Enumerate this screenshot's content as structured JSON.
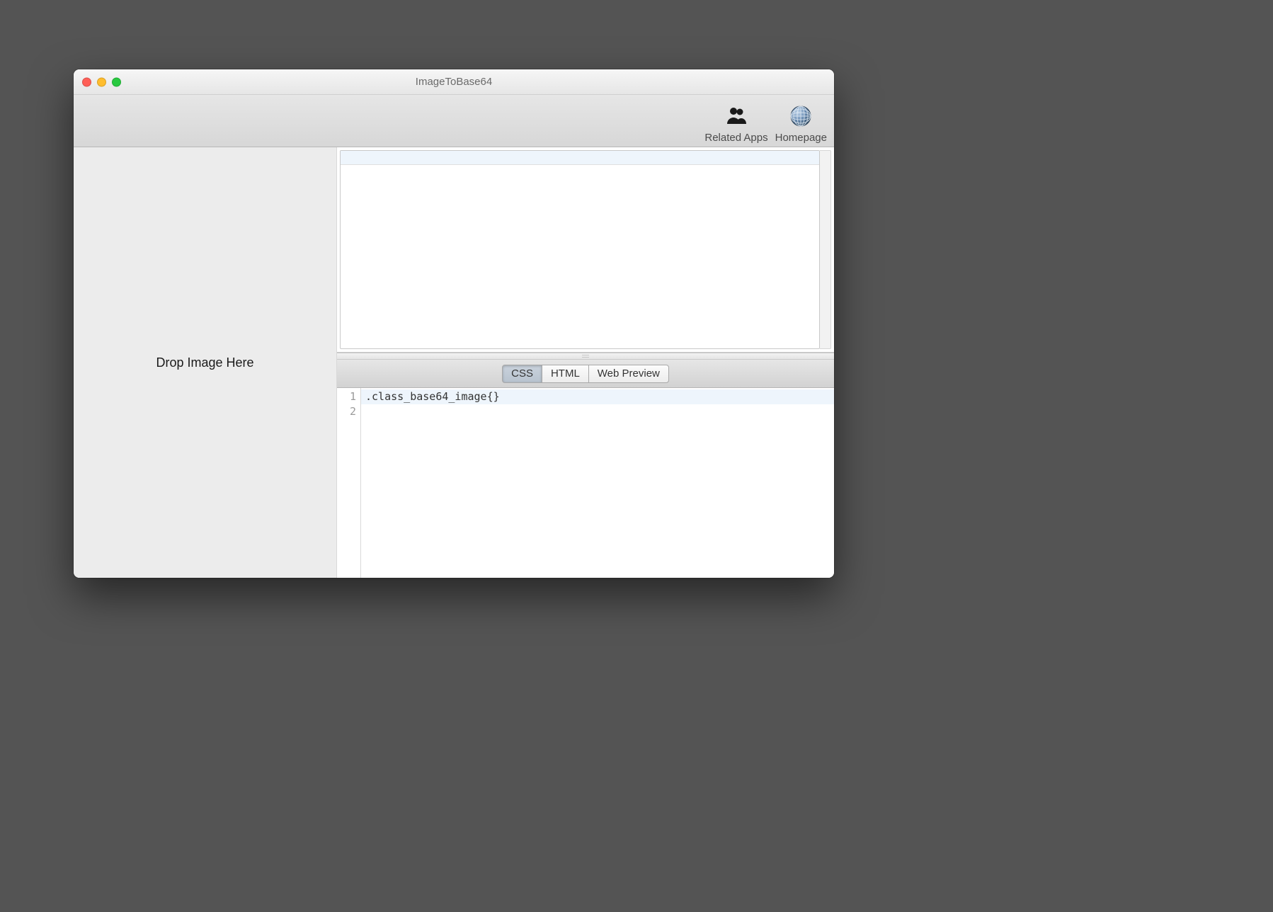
{
  "window": {
    "title": "ImageToBase64"
  },
  "toolbar": {
    "related_apps_label": "Related Apps",
    "homepage_label": "Homepage"
  },
  "dropzone": {
    "text": "Drop Image Here"
  },
  "tabs": {
    "active": "css",
    "css_label": "CSS",
    "html_label": "HTML",
    "webpreview_label": "Web Preview"
  },
  "editor": {
    "lines": [
      ".class_base64_image{}",
      ""
    ],
    "line_numbers": [
      "1",
      "2"
    ]
  }
}
